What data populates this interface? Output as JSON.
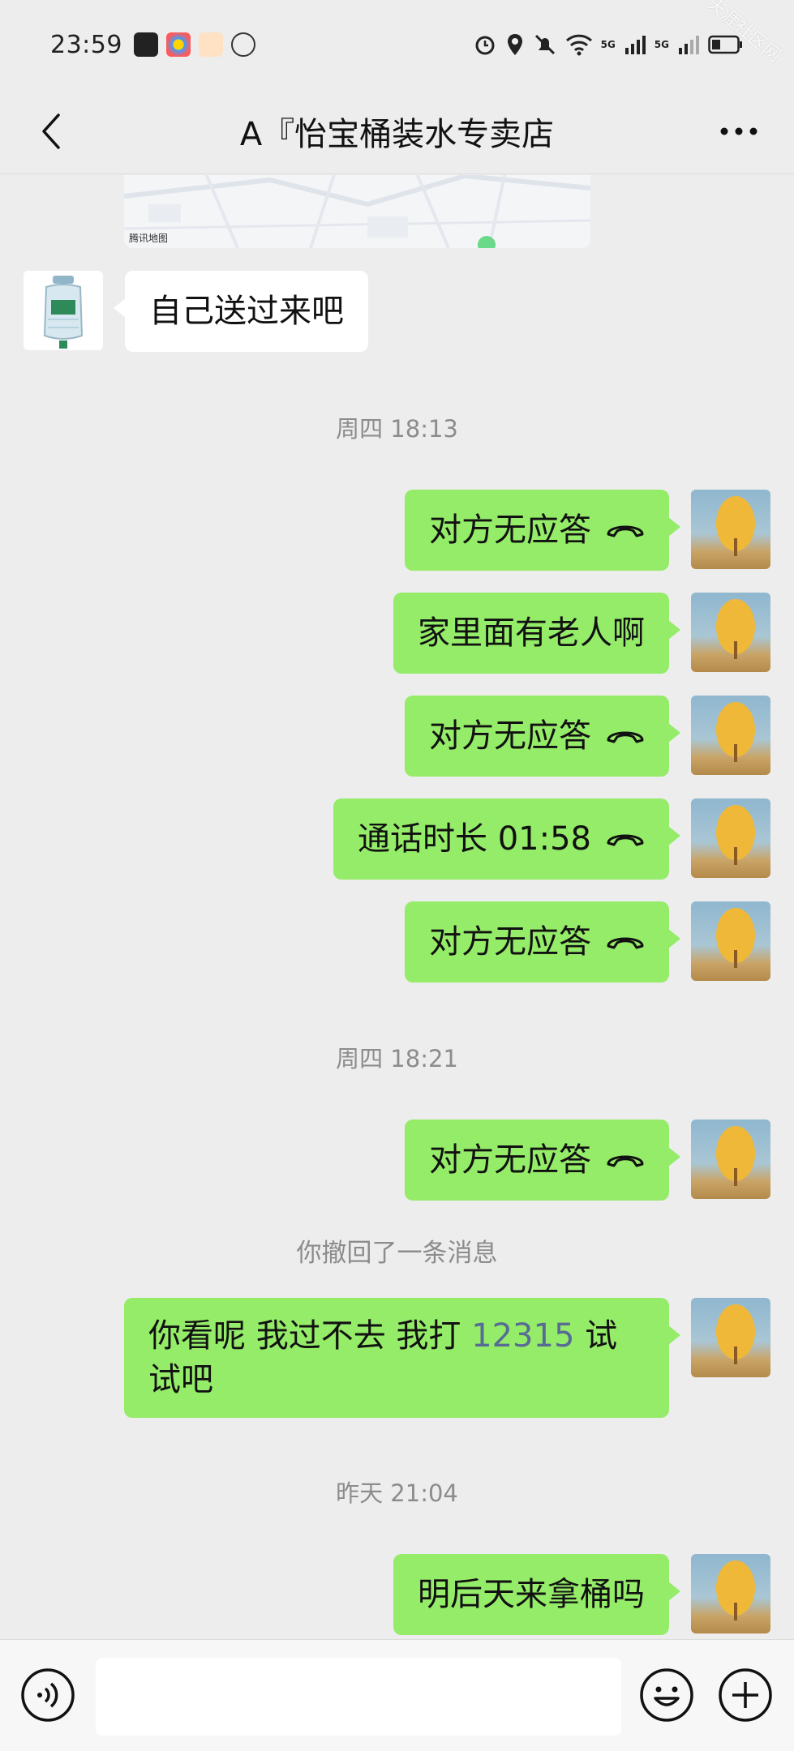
{
  "status_bar": {
    "time": "23:59",
    "signal_1": "5G",
    "signal_2": "5G"
  },
  "header": {
    "title": "A『怡宝桶装水专卖店"
  },
  "watermark": {
    "text": "天涯社区网"
  },
  "map": {
    "label": "腾讯地图"
  },
  "messages": {
    "m0": "自己送过来吧",
    "sep1": "周四 18:13",
    "m1": "对方无应答",
    "m2": "家里面有老人啊",
    "m3": "对方无应答",
    "m4": "通话时长 01:58",
    "m5": "对方无应答",
    "sep2": "周四 18:21",
    "m6": "对方无应答",
    "recall": "你撤回了一条消息",
    "m7_part1": "你看呢 我过不去 我打 ",
    "m7_number": "12315",
    "m7_part2": " 试试吧",
    "sep3": "昨天 21:04",
    "m8": "明后天来拿桶吗"
  },
  "colors": {
    "self_bubble": "#95ec69",
    "other_bubble": "#ffffff",
    "background": "#ededed",
    "link": "#576b95"
  },
  "icons": {
    "back": "chevron-left-icon",
    "more": "more-dots-icon",
    "call": "hang-up-phone-icon",
    "voice": "voice-icon",
    "emoji": "emoji-icon",
    "plus": "plus-icon"
  }
}
